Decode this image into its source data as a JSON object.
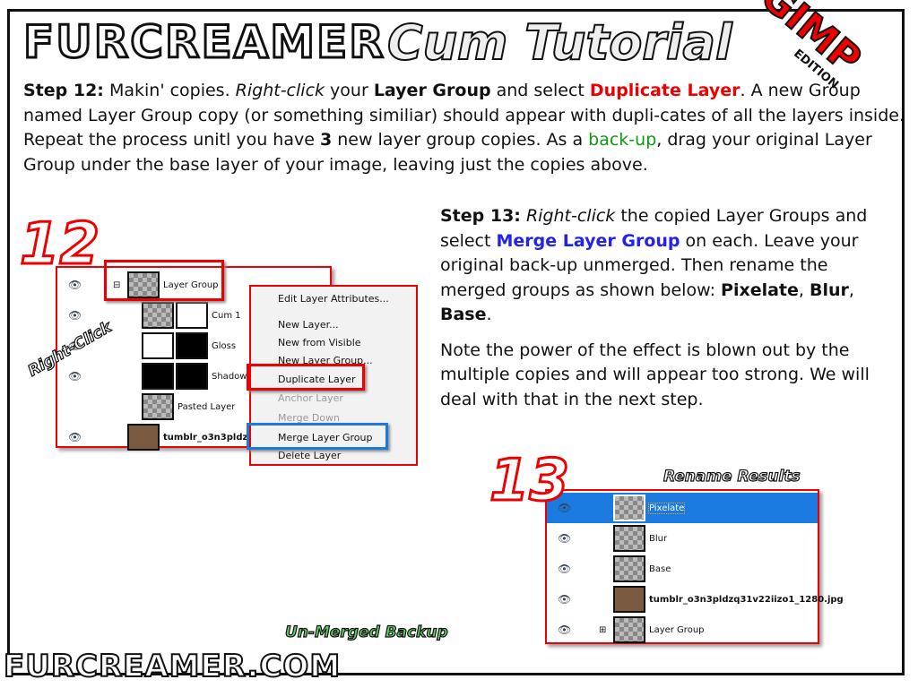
{
  "header": {
    "logo": "FURCREAMER",
    "title": "Cum Tutorial",
    "badge": "GIMP",
    "badge_sub": "EDITION"
  },
  "step12": {
    "label": "Step 12:",
    "t1": " Makin' copies. ",
    "rc": "Right-click",
    "t2": " your ",
    "lg": "Layer Group",
    "t3": " and select ",
    "dup": "Duplicate Layer",
    "t4": ". A new Group named Layer Group copy (or something similiar) should appear with dupli-cates of all the layers inside. Repeat the process unitl you have ",
    "three": "3",
    "t5": " new layer group copies. As a ",
    "backup": "back-up",
    "t6": ", drag your original Layer Group under the base layer of your image, leaving just the copies above."
  },
  "step13": {
    "label": "Step 13:",
    "rc": "Right-click",
    "t1": " the copied Layer Groups and select ",
    "mlg": "Merge Layer Group",
    "t2": " on each. Leave your original back-up unmerged. Then rename the merged groups as shown below: ",
    "pix": "Pixelate",
    "c1": ", ",
    "blur": "Blur",
    "c2": ", ",
    "base": "Base",
    "c3": ".",
    "note": "Note the power of the effect is blown out by the multiple copies and will appear too strong. We will deal with that in the next step."
  },
  "fig12": {
    "number": "12",
    "callout": "Right-Click",
    "layers": [
      "Layer Group",
      "Cum 1",
      "Gloss",
      "Shadow",
      "Pasted Layer",
      "tumblr_o3n3pldzq31"
    ],
    "menu": [
      {
        "label": "Edit Layer Attributes...",
        "disabled": false
      },
      {
        "label": "New Layer...",
        "disabled": false
      },
      {
        "label": "New from Visible",
        "disabled": false
      },
      {
        "label": "New Layer Group...",
        "disabled": false
      },
      {
        "label": "Duplicate Layer",
        "disabled": false
      },
      {
        "label": "Anchor Layer",
        "disabled": true
      },
      {
        "label": "Merge Down",
        "disabled": true
      },
      {
        "label": "Merge Layer Group",
        "disabled": false
      },
      {
        "label": "Delete Layer",
        "disabled": false
      }
    ]
  },
  "fig13": {
    "number": "13",
    "callout_rename": "Rename Results",
    "callout_backup": "Un-Merged Backup",
    "layers": [
      "Pixelate",
      "Blur",
      "Base",
      "tumblr_o3n3pldzq31v22iizo1_1280.jpg",
      "Layer Group"
    ]
  },
  "footer": {
    "site": "FURCREAMER.COM"
  },
  "colors": {
    "accent_red": "#ee0000",
    "accent_blue": "#2222ee",
    "accent_green": "#119911",
    "selection": "#1a7ae0"
  }
}
